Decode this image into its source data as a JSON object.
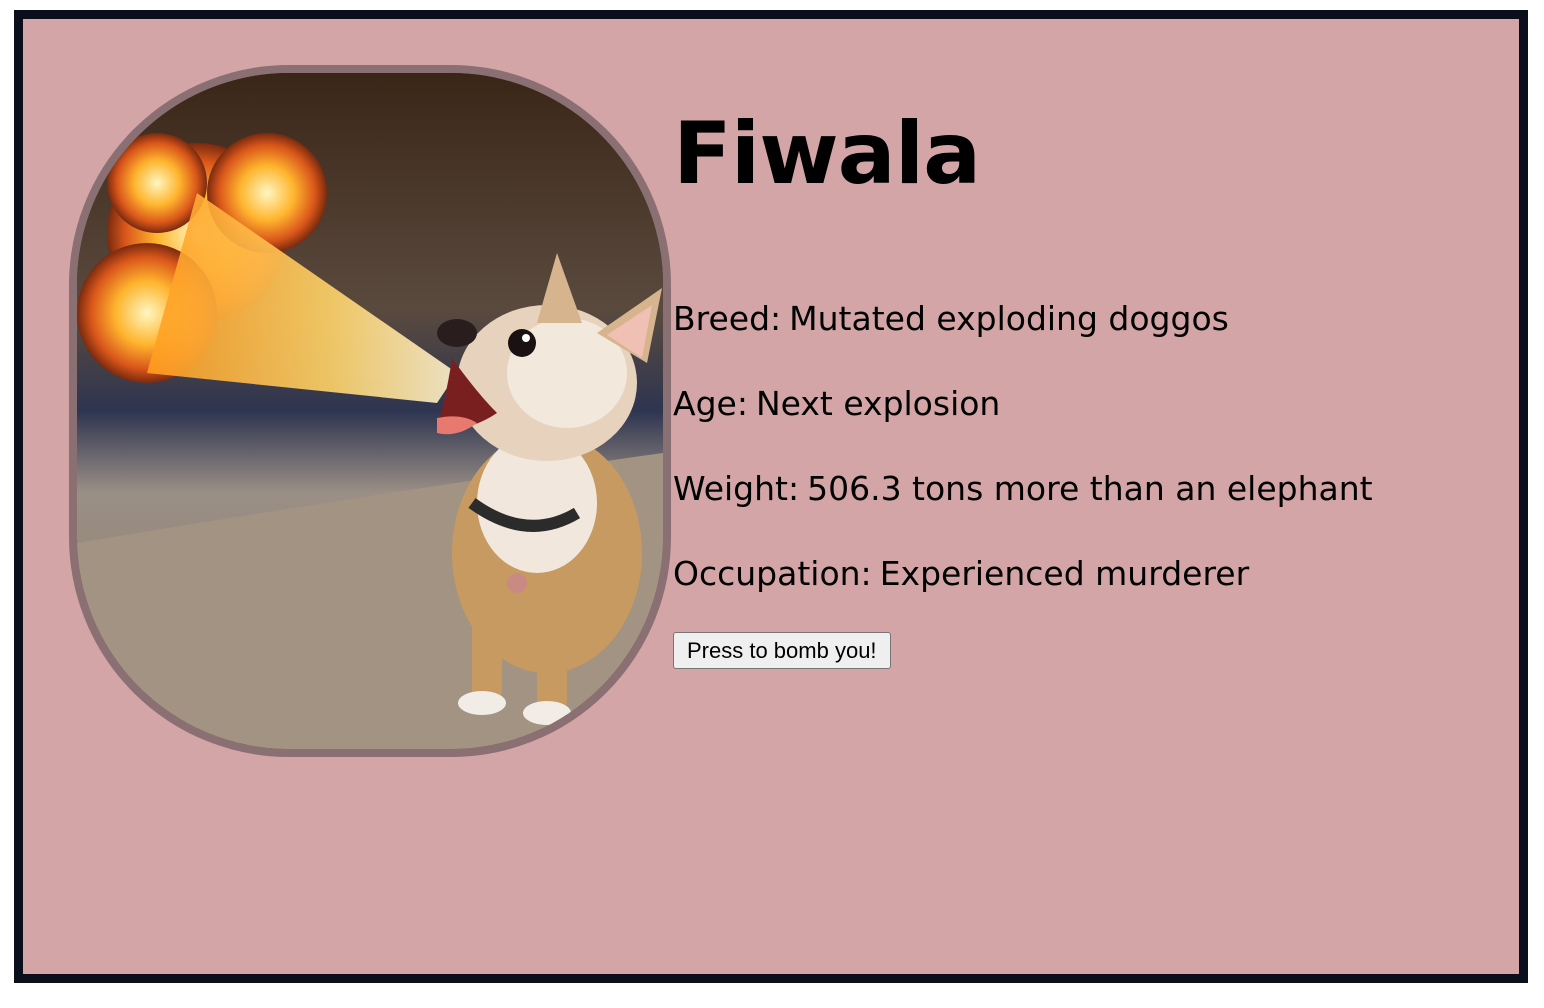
{
  "profile": {
    "name": "Fiwala",
    "image_alt": "Chihuahua breathing fire",
    "fields": [
      {
        "label": "Breed:",
        "value": "Mutated exploding doggos"
      },
      {
        "label": "Age:",
        "value": "Next explosion"
      },
      {
        "label": "Weight:",
        "value": "506.3 tons more than an elephant"
      },
      {
        "label": "Occupation:",
        "value": "Experienced murderer"
      }
    ],
    "button_label": "Press to bomb you!"
  },
  "colors": {
    "page_border": "#0b0f1c",
    "card_background": "#d4a5a6",
    "photo_border": "#8a6f73"
  }
}
